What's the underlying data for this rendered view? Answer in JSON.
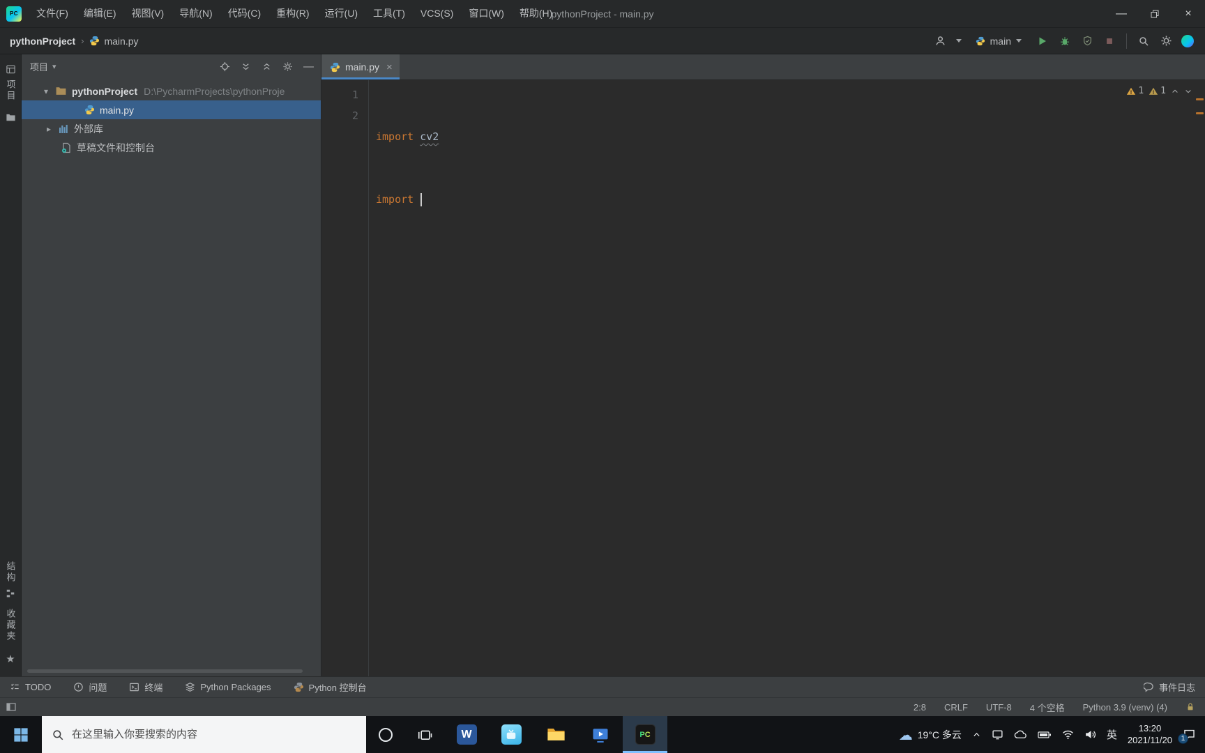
{
  "colors": {
    "accent_blue": "#4a88c7",
    "keyword_orange": "#cc7832",
    "selection_blue": "#38608c",
    "run_green": "#59A869",
    "warning_yellow": "#d9a343",
    "editor_bg": "#2b2b2b",
    "panel_bg": "#3c3f41",
    "taskbar_bg": "#111316"
  },
  "icons": {
    "chevron_down": "▾",
    "chevron_right": "▸",
    "breadcrumb_separator": "›",
    "star": "★",
    "cloud": "☁",
    "close": "×",
    "minimize": "—"
  },
  "titlebar": {
    "title": "pythonProject - main.py",
    "menus": [
      "文件(F)",
      "编辑(E)",
      "视图(V)",
      "导航(N)",
      "代码(C)",
      "重构(R)",
      "运行(U)",
      "工具(T)",
      "VCS(S)",
      "窗口(W)",
      "帮助(H)"
    ]
  },
  "navbar": {
    "project": "pythonProject",
    "file": "main.py",
    "run_config": "main"
  },
  "strips": {
    "project": "项目",
    "structure": "结构",
    "favorites": "收藏夹"
  },
  "project_panel": {
    "title": "项目",
    "items": [
      {
        "label": "pythonProject",
        "path": "D:\\PycharmProjects\\pythonProje"
      },
      {
        "label": "main.py"
      },
      {
        "label": "外部库"
      },
      {
        "label": "草稿文件和控制台"
      }
    ]
  },
  "editor": {
    "tab": "main.py",
    "line1": {
      "num": "1",
      "keyword": "import",
      "module": "cv2"
    },
    "line2": {
      "num": "2",
      "keyword": "import"
    },
    "inspections": {
      "warnings": "1",
      "typos": "1"
    }
  },
  "toolwindow_bar": {
    "items": [
      "TODO",
      "问题",
      "终端",
      "Python Packages",
      "Python 控制台"
    ],
    "event_log": "事件日志"
  },
  "statusbar": {
    "caret": "2:8",
    "line_separator": "CRLF",
    "encoding": "UTF-8",
    "indent": "4 个空格",
    "interpreter": "Python 3.9 (venv) (4)"
  },
  "taskbar": {
    "search_placeholder": "在这里输入你要搜索的内容",
    "weather": "19°C 多云",
    "input_language": "英",
    "time": "13:20",
    "date": "2021/11/20",
    "notification_badge": "1"
  }
}
